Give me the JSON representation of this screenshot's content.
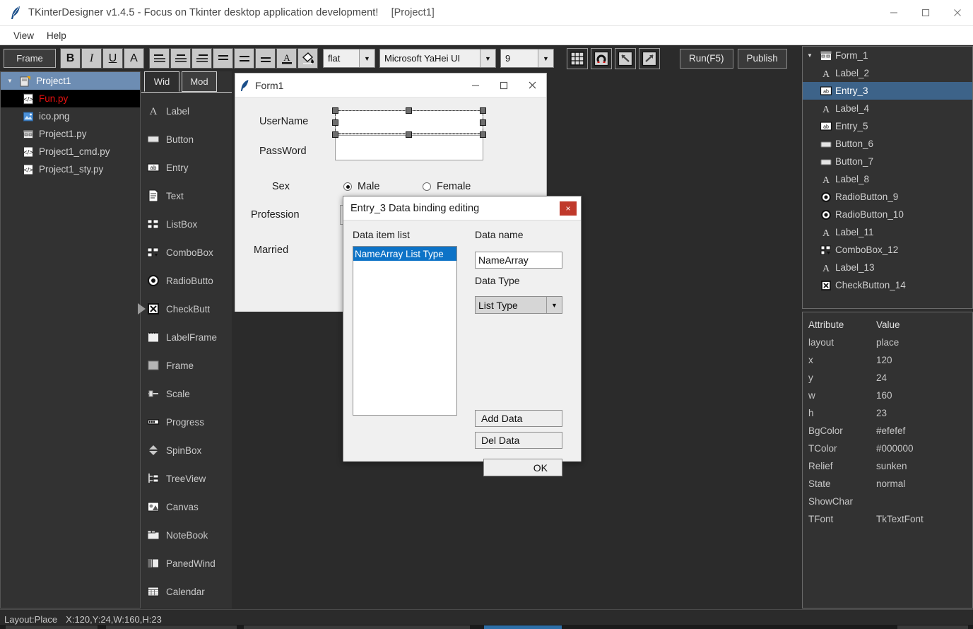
{
  "window": {
    "title": "TKinterDesigner v1.4.5 - Focus on Tkinter desktop application development!",
    "project_tag": "[Project1]",
    "app_icon": "feather-icon",
    "minimize_label": "—",
    "maximize_label": "☐",
    "close_label": "✕"
  },
  "menubar": {
    "items": [
      {
        "label": "View"
      },
      {
        "label": "Help"
      }
    ]
  },
  "toolbar": {
    "frame_label": "Frame",
    "format_buttons": [
      {
        "name": "bold-button",
        "label": "B"
      },
      {
        "name": "italic-button",
        "label": "I"
      },
      {
        "name": "underline-button",
        "label": "U"
      },
      {
        "name": "font-button",
        "label": "A"
      }
    ],
    "align_buttons": [
      {
        "name": "align-left-button",
        "label": "align-left-icon"
      },
      {
        "name": "align-center-button",
        "label": "align-center-icon"
      },
      {
        "name": "align-right-button",
        "label": "align-right-icon"
      },
      {
        "name": "align-justify-button",
        "label": "align-justify-icon"
      },
      {
        "name": "valign-middle-button",
        "label": "valign-middle-icon"
      },
      {
        "name": "valign-bottom-button",
        "label": "valign-bottom-icon"
      }
    ],
    "text_color_button": "text-color-icon",
    "fill_color_button": "fill-color-icon",
    "relief_combo": {
      "value": "flat"
    },
    "font_combo": {
      "value": "Microsoft YaHei UI"
    },
    "size_combo": {
      "value": "9"
    },
    "tool_buttons": [
      {
        "name": "grid-button",
        "label": "grid-icon"
      },
      {
        "name": "magnet-button",
        "label": "magnet-icon"
      },
      {
        "name": "undo-button",
        "label": "undo-icon"
      },
      {
        "name": "redo-button",
        "label": "redo-icon"
      }
    ],
    "run_label": "Run(F5)",
    "publish_label": "Publish"
  },
  "file_tree": {
    "root": {
      "label": "Project1",
      "icon": "project-icon"
    },
    "items": [
      {
        "label": "Fun.py",
        "icon": "code-file-icon",
        "selected": true
      },
      {
        "label": "ico.png",
        "icon": "image-file-icon",
        "selected": false
      },
      {
        "label": "Project1.py",
        "icon": "form-file-icon",
        "selected": false
      },
      {
        "label": "Project1_cmd.py",
        "icon": "code-file-icon",
        "selected": false
      },
      {
        "label": "Project1_sty.py",
        "icon": "code-file-icon",
        "selected": false
      }
    ]
  },
  "palette": {
    "tabs": [
      {
        "label": "Wid",
        "active": true
      },
      {
        "label": "Mod",
        "active": false
      }
    ],
    "items": [
      {
        "label": "Label",
        "icon": "label-icon",
        "marker": false
      },
      {
        "label": "Button",
        "icon": "button-icon",
        "marker": false
      },
      {
        "label": "Entry",
        "icon": "entry-icon",
        "marker": false
      },
      {
        "label": "Text",
        "icon": "text-icon",
        "marker": false
      },
      {
        "label": "ListBox",
        "icon": "listbox-icon",
        "marker": false
      },
      {
        "label": "ComboBox",
        "icon": "combobox-icon",
        "marker": false
      },
      {
        "label": "RadioButto",
        "icon": "radiobutton-icon",
        "marker": false
      },
      {
        "label": "CheckButt",
        "icon": "checkbutton-icon",
        "marker": true
      },
      {
        "label": "LabelFrame",
        "icon": "labelframe-icon",
        "marker": false
      },
      {
        "label": "Frame",
        "icon": "frame-icon",
        "marker": false
      },
      {
        "label": "Scale",
        "icon": "scale-icon",
        "marker": false
      },
      {
        "label": "Progress",
        "icon": "progress-icon",
        "marker": false
      },
      {
        "label": "SpinBox",
        "icon": "spinbox-icon",
        "marker": false
      },
      {
        "label": "TreeView",
        "icon": "treeview-icon",
        "marker": false
      },
      {
        "label": "Canvas",
        "icon": "canvas-icon",
        "marker": false
      },
      {
        "label": "NoteBook",
        "icon": "notebook-icon",
        "marker": false
      },
      {
        "label": "PanedWind",
        "icon": "panedwindow-icon",
        "marker": false
      },
      {
        "label": "Calendar",
        "icon": "calendar-icon",
        "marker": false
      }
    ]
  },
  "design_form": {
    "title": "Form1",
    "icon": "feather-icon",
    "minimize_label": "—",
    "maximize_label": "☐",
    "close_label": "✕",
    "labels": [
      {
        "text": "UserName"
      },
      {
        "text": "PassWord"
      },
      {
        "text": "Sex"
      },
      {
        "text": "Profession"
      },
      {
        "text": "Married"
      }
    ],
    "radios": [
      {
        "text": "Male",
        "checked": true
      },
      {
        "text": "Female",
        "checked": false
      }
    ]
  },
  "dialog": {
    "title": "Entry_3 Data binding editing",
    "close_label": "×",
    "list_label": "Data item list",
    "list_items": [
      {
        "text": "NameArray List Type",
        "selected": true
      }
    ],
    "name_label": "Data name",
    "name_value": "NameArray",
    "type_label": "Data Type",
    "type_value": "List Type",
    "add_label": "Add Data",
    "del_label": "Del Data",
    "ok_label": "OK"
  },
  "object_tree": {
    "root": {
      "label": "Form_1",
      "icon": "form-icon"
    },
    "items": [
      {
        "label": "Label_2",
        "icon": "label-icon",
        "selected": false
      },
      {
        "label": "Entry_3",
        "icon": "entry-icon",
        "selected": true
      },
      {
        "label": "Label_4",
        "icon": "label-icon",
        "selected": false
      },
      {
        "label": "Entry_5",
        "icon": "entry-icon",
        "selected": false
      },
      {
        "label": "Button_6",
        "icon": "button-icon",
        "selected": false
      },
      {
        "label": "Button_7",
        "icon": "button-icon",
        "selected": false
      },
      {
        "label": "Label_8",
        "icon": "label-icon",
        "selected": false
      },
      {
        "label": "RadioButton_9",
        "icon": "radiobutton-icon",
        "selected": false
      },
      {
        "label": "RadioButton_10",
        "icon": "radiobutton-icon",
        "selected": false
      },
      {
        "label": "Label_11",
        "icon": "label-icon",
        "selected": false
      },
      {
        "label": "ComboBox_12",
        "icon": "combobox-icon",
        "selected": false
      },
      {
        "label": "Label_13",
        "icon": "label-icon",
        "selected": false
      },
      {
        "label": "CheckButton_14",
        "icon": "checkbutton-icon",
        "selected": false
      }
    ]
  },
  "properties": {
    "header": {
      "key": "Attribute",
      "value": "Value"
    },
    "rows": [
      {
        "key": "layout",
        "value": "place"
      },
      {
        "key": "x",
        "value": "120"
      },
      {
        "key": "y",
        "value": "24"
      },
      {
        "key": "w",
        "value": "160"
      },
      {
        "key": "h",
        "value": "23"
      },
      {
        "key": "BgColor",
        "value": "#efefef"
      },
      {
        "key": "TColor",
        "value": "#000000"
      },
      {
        "key": "Relief",
        "value": "sunken"
      },
      {
        "key": "State",
        "value": "normal"
      },
      {
        "key": "ShowChar",
        "value": ""
      },
      {
        "key": "TFont",
        "value": "TkTextFont"
      }
    ]
  },
  "statusbar": {
    "layout": "Layout:Place",
    "coords": "X:120,Y:24,W:160,H:23"
  },
  "colors": {
    "accent_selection": "#3d6389",
    "tree_root": "#6d8db3",
    "list_highlight": "#0d73c7",
    "error_red": "#e81010",
    "close_red": "#c0392b",
    "panel_bg": "#323232",
    "app_bg": "#2b2b2b"
  }
}
